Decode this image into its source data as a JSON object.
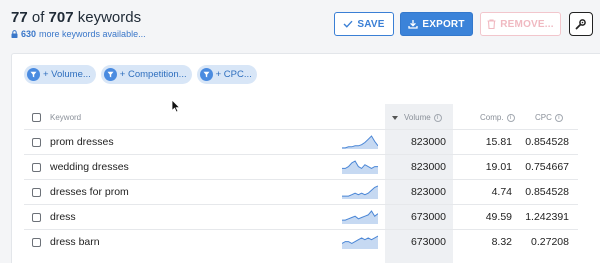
{
  "header": {
    "count_shown": "77",
    "count_of": "of",
    "count_total": "707",
    "count_unit": "keywords",
    "more_count": "630",
    "more_text": "more keywords available..."
  },
  "toolbar": {
    "save_label": "SAVE",
    "export_label": "EXPORT",
    "remove_label": "REMOVE..."
  },
  "filters": [
    {
      "label": "+ Volume..."
    },
    {
      "label": "+ Competition..."
    },
    {
      "label": "+ CPC..."
    }
  ],
  "table": {
    "columns": {
      "keyword": "Keyword",
      "volume": "Volume",
      "comp": "Comp.",
      "cpc": "CPC"
    },
    "sorted_column": "volume",
    "rows": [
      {
        "keyword": "prom dresses",
        "volume": "823000",
        "comp": "15.81",
        "cpc": "0.854528",
        "trend": [
          1,
          1,
          2,
          2,
          3,
          3,
          4,
          6,
          9,
          12,
          7,
          3
        ]
      },
      {
        "keyword": "wedding dresses",
        "volume": "823000",
        "comp": "19.01",
        "cpc": "0.754667",
        "trend": [
          3,
          3,
          4,
          6,
          7,
          4,
          3,
          5,
          4,
          3,
          4,
          4
        ]
      },
      {
        "keyword": "dresses for prom",
        "volume": "823000",
        "comp": "4.74",
        "cpc": "0.854528",
        "trend": [
          2,
          2,
          2,
          3,
          4,
          3,
          4,
          3,
          4,
          6,
          8,
          9
        ]
      },
      {
        "keyword": "dress",
        "volume": "673000",
        "comp": "49.59",
        "cpc": "1.242391",
        "trend": [
          3,
          3,
          4,
          5,
          6,
          4,
          5,
          6,
          7,
          10,
          6,
          8
        ]
      },
      {
        "keyword": "dress barn",
        "volume": "673000",
        "comp": "8.32",
        "cpc": "0.27208",
        "trend": [
          3,
          4,
          4,
          3,
          4,
          5,
          6,
          5,
          6,
          5,
          6,
          7
        ]
      }
    ]
  },
  "colors": {
    "accent": "#3b83d9",
    "spark_fill": "#c6d9f2",
    "spark_stroke": "#4a86d6",
    "danger_muted": "#f0b9c1"
  }
}
